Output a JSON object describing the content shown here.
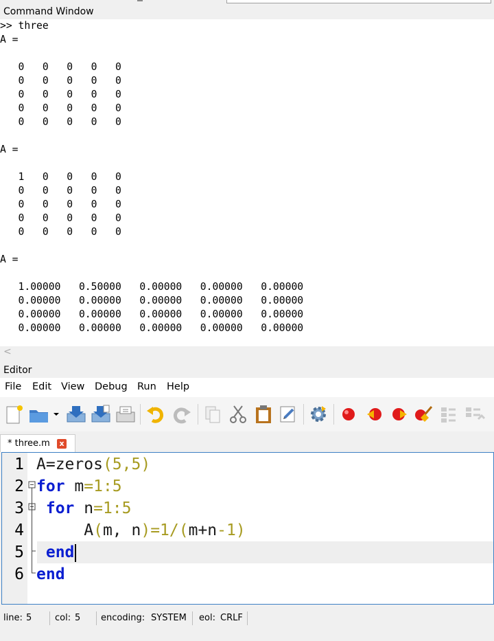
{
  "command_window": {
    "title": "Command Window",
    "output": ">> three\nA =\n\n   0   0   0   0   0\n   0   0   0   0   0\n   0   0   0   0   0\n   0   0   0   0   0\n   0   0   0   0   0\n\nA =\n\n   1   0   0   0   0\n   0   0   0   0   0\n   0   0   0   0   0\n   0   0   0   0   0\n   0   0   0   0   0\n\nA =\n\n   1.00000   0.50000   0.00000   0.00000   0.00000\n   0.00000   0.00000   0.00000   0.00000   0.00000\n   0.00000   0.00000   0.00000   0.00000   0.00000\n   0.00000   0.00000   0.00000   0.00000   0.00000",
    "scroll_left": "<"
  },
  "editor": {
    "title": "Editor",
    "menu": [
      "File",
      "Edit",
      "View",
      "Debug",
      "Run",
      "Help"
    ],
    "tab": {
      "label": "* three.m",
      "close": "x"
    },
    "lines": [
      {
        "num": "1",
        "code": [
          {
            "t": "A=zeros",
            "c": "pl"
          },
          {
            "t": "(5,5)",
            "c": "num"
          }
        ]
      },
      {
        "num": "2",
        "code": [
          {
            "t": "for",
            "c": "kw"
          },
          {
            "t": " m",
            "c": "pl"
          },
          {
            "t": "=1:5",
            "c": "num"
          }
        ]
      },
      {
        "num": "3",
        "code": [
          {
            "t": " for",
            "c": "kw"
          },
          {
            "t": " n",
            "c": "pl"
          },
          {
            "t": "=1:5",
            "c": "num"
          }
        ]
      },
      {
        "num": "4",
        "code": [
          {
            "t": "     A",
            "c": "pl"
          },
          {
            "t": "(",
            "c": "num"
          },
          {
            "t": "m, n",
            "c": "pl"
          },
          {
            "t": ")=1/(",
            "c": "num"
          },
          {
            "t": "m+n",
            "c": "pl"
          },
          {
            "t": "-1)",
            "c": "num"
          }
        ]
      },
      {
        "num": "5",
        "code": [
          {
            "t": " end",
            "c": "kw"
          }
        ]
      },
      {
        "num": "6",
        "code": [
          {
            "t": "end",
            "c": "kw"
          }
        ]
      }
    ]
  },
  "toolbar_icons": [
    "new-file-icon",
    "open-folder-icon",
    "dropdown-arrow-icon",
    "save-icon",
    "save-as-icon",
    "save-all-icon",
    "undo-icon",
    "redo-icon",
    "copy-icon",
    "cut-icon",
    "paste-icon",
    "find-replace-icon",
    "run-settings-icon",
    "breakpoint-icon",
    "step-back-icon",
    "step-icon",
    "clear-breakpoints-icon",
    "fold-icon",
    "unfold-icon"
  ],
  "status": {
    "line_label": "line:",
    "line_value": "5",
    "col_label": "col:",
    "col_value": "5",
    "encoding_label": "encoding:",
    "encoding_value": "SYSTEM",
    "eol_label": "eol:",
    "eol_value": "CRLF"
  }
}
